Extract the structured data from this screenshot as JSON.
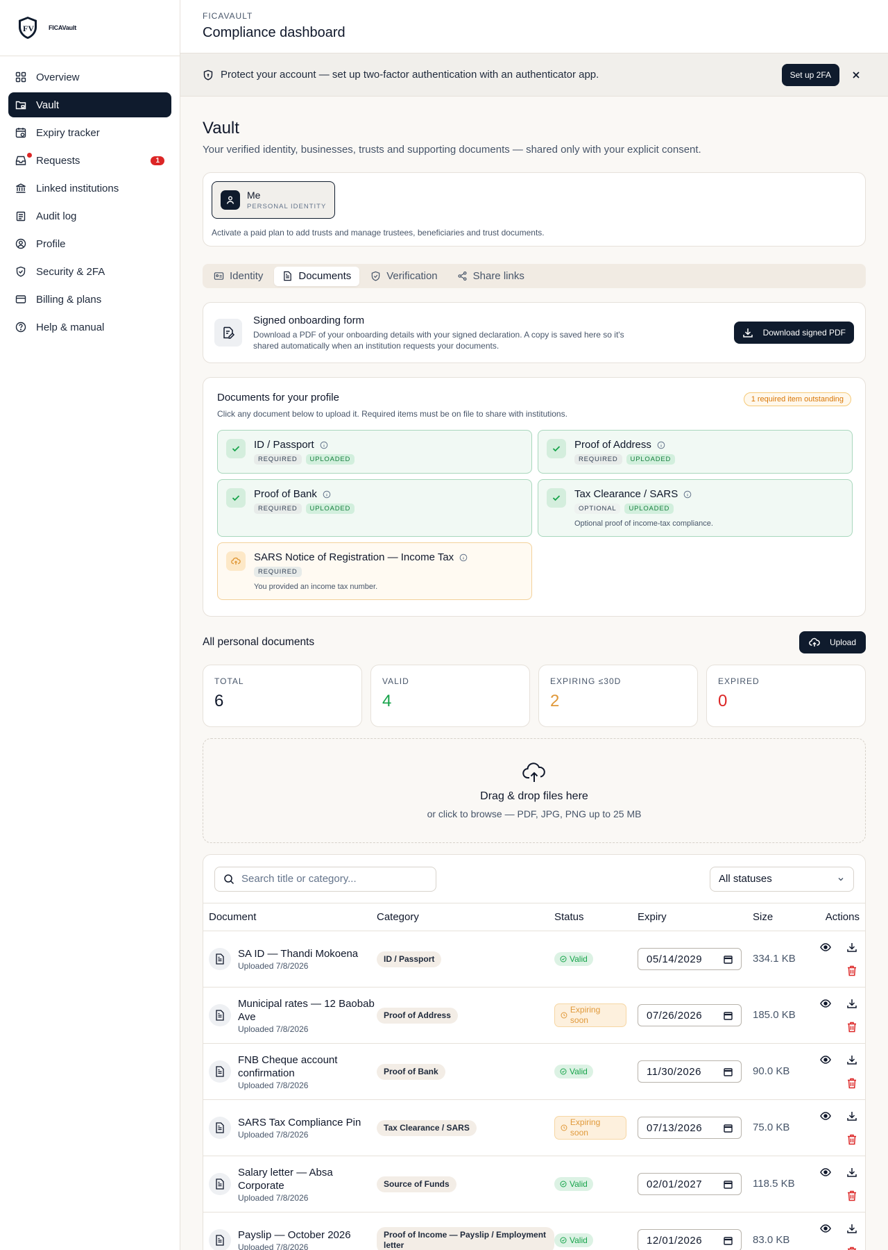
{
  "brand": {
    "name": "FICAVault"
  },
  "sidebar": {
    "items": [
      {
        "label": "Overview"
      },
      {
        "label": "Vault"
      },
      {
        "label": "Expiry tracker"
      },
      {
        "label": "Requests",
        "badge": "1"
      },
      {
        "label": "Linked institutions"
      },
      {
        "label": "Audit log"
      },
      {
        "label": "Profile"
      },
      {
        "label": "Security & 2FA"
      },
      {
        "label": "Billing & plans"
      },
      {
        "label": "Help & manual"
      }
    ]
  },
  "header": {
    "eyebrow": "FICAVAULT",
    "title": "Compliance dashboard"
  },
  "banner": {
    "text": "Protect your account — set up two-factor authentication with an authenticator app.",
    "button": "Set up 2FA"
  },
  "page": {
    "title": "Vault",
    "subtitle": "Your verified identity, businesses, trusts and supporting documents — shared only with your explicit consent."
  },
  "entity": {
    "name": "Me",
    "kind": "PERSONAL IDENTITY",
    "note": "Activate a paid plan to add trusts and manage trustees, beneficiaries and trust documents."
  },
  "tabs": [
    {
      "label": "Identity"
    },
    {
      "label": "Documents"
    },
    {
      "label": "Verification"
    },
    {
      "label": "Share links"
    }
  ],
  "onboarding": {
    "title": "Signed onboarding form",
    "desc": "Download a PDF of your onboarding details with your signed declaration. A copy is saved here so it's shared automatically when an institution requests your documents.",
    "button": "Download signed PDF"
  },
  "profile_docs": {
    "title": "Documents for your profile",
    "desc": "Click any document below to upload it. Required items must be on file to share with institutions.",
    "outstanding": "1 required item outstanding",
    "items": [
      {
        "name": "ID / Passport",
        "tag1": "REQUIRED",
        "tag2": "UPLOADED",
        "note": ""
      },
      {
        "name": "Proof of Address",
        "tag1": "REQUIRED",
        "tag2": "UPLOADED",
        "note": ""
      },
      {
        "name": "Proof of Bank",
        "tag1": "REQUIRED",
        "tag2": "UPLOADED",
        "note": ""
      },
      {
        "name": "Tax Clearance / SARS",
        "tag1": "OPTIONAL",
        "tag2": "UPLOADED",
        "note": "Optional proof of income-tax compliance."
      },
      {
        "name": "SARS Notice of Registration — Income Tax",
        "tag1": "REQUIRED",
        "tag2": "",
        "note": "You provided an income tax number."
      }
    ]
  },
  "all_docs": {
    "title": "All personal documents",
    "upload": "Upload"
  },
  "stats": [
    {
      "label": "TOTAL",
      "value": "6",
      "color": "#0f172a"
    },
    {
      "label": "VALID",
      "value": "4",
      "color": "#16a34a"
    },
    {
      "label": "EXPIRING ≤30D",
      "value": "2",
      "color": "#e0993a"
    },
    {
      "label": "EXPIRED",
      "value": "0",
      "color": "#dc2626"
    }
  ],
  "dropzone": {
    "title": "Drag & drop files here",
    "desc": "or click to browse — PDF, JPG, PNG up to 25 MB"
  },
  "table": {
    "search_placeholder": "Search title or category...",
    "filter": "All statuses",
    "columns": [
      "Document",
      "Category",
      "Status",
      "Expiry",
      "Size",
      "Actions"
    ],
    "rows": [
      {
        "title": "SA ID — Thandi Mokoena",
        "uploaded": "Uploaded 7/8/2026",
        "category": "ID / Passport",
        "status": "Valid",
        "status_kind": "valid",
        "expiry": "05/14/2029",
        "size": "334.1 KB"
      },
      {
        "title": "Municipal rates — 12 Baobab Ave",
        "uploaded": "Uploaded 7/8/2026",
        "category": "Proof of Address",
        "status": "Expiring soon",
        "status_kind": "exp",
        "expiry": "07/26/2026",
        "size": "185.0 KB"
      },
      {
        "title": "FNB Cheque account confirmation",
        "uploaded": "Uploaded 7/8/2026",
        "category": "Proof of Bank",
        "status": "Valid",
        "status_kind": "valid",
        "expiry": "11/30/2026",
        "size": "90.0 KB"
      },
      {
        "title": "SARS Tax Compliance Pin",
        "uploaded": "Uploaded 7/8/2026",
        "category": "Tax Clearance / SARS",
        "status": "Expiring soon",
        "status_kind": "exp",
        "expiry": "07/13/2026",
        "size": "75.0 KB"
      },
      {
        "title": "Salary letter — Absa Corporate",
        "uploaded": "Uploaded 7/8/2026",
        "category": "Source of Funds",
        "status": "Valid",
        "status_kind": "valid",
        "expiry": "02/01/2027",
        "size": "118.5 KB"
      },
      {
        "title": "Payslip — October 2026",
        "uploaded": "Uploaded 7/8/2026",
        "category": "Proof of Income — Payslip / Employment letter",
        "status": "Valid",
        "status_kind": "valid",
        "expiry": "12/01/2026",
        "size": "83.0 KB"
      }
    ]
  }
}
